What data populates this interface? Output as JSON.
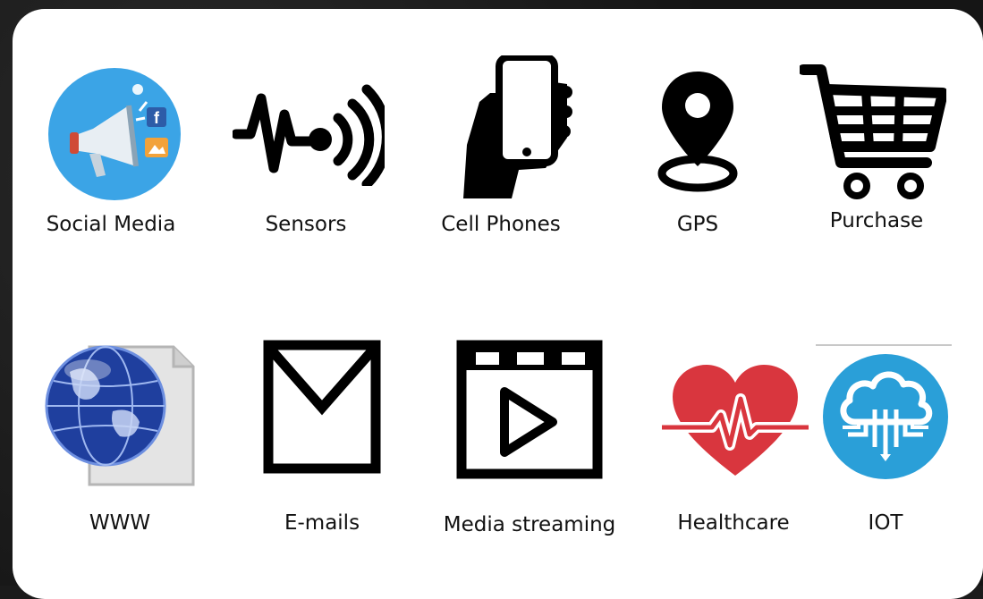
{
  "items": [
    {
      "label": "Social Media",
      "icon": "social-media-icon"
    },
    {
      "label": "Sensors",
      "icon": "sensor-wave-icon"
    },
    {
      "label": "Cell Phones",
      "icon": "hand-phone-icon"
    },
    {
      "label": "GPS",
      "icon": "map-pin-icon"
    },
    {
      "label": "Purchase",
      "icon": "shopping-cart-icon"
    },
    {
      "label": "WWW",
      "icon": "globe-document-icon"
    },
    {
      "label": "E-mails",
      "icon": "envelope-icon"
    },
    {
      "label": "Media streaming",
      "icon": "video-player-icon"
    },
    {
      "label": "Healthcare",
      "icon": "heart-pulse-icon"
    },
    {
      "label": "IOT",
      "icon": "cloud-iot-icon"
    }
  ],
  "colors": {
    "social_blue": "#3ba4e6",
    "heart_red": "#d9363e",
    "iot_blue": "#2a9fd8",
    "globe_blue": "#1f3f9e"
  }
}
